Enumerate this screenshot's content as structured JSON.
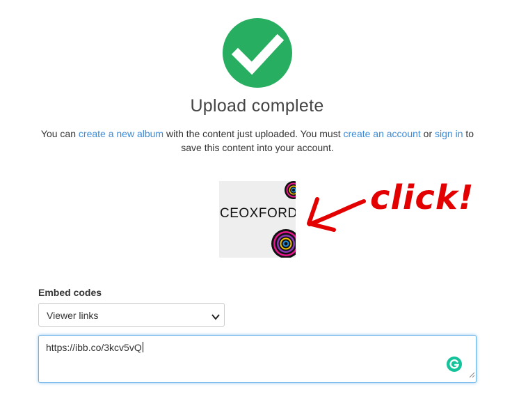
{
  "upload": {
    "title": "Upload complete",
    "message": {
      "part1": "You can ",
      "link_album": "create a new album",
      "part2": " with the content just uploaded. You must ",
      "link_account": "create an account",
      "part3": " or ",
      "link_signin": "sign in",
      "part4": " to save this content into your account."
    },
    "image": {
      "text": "CEOXFORD"
    },
    "annotation": {
      "text": "click!",
      "color": "#e30000"
    }
  },
  "embed": {
    "label": "Embed codes",
    "select_value": "Viewer links",
    "textarea_value": "https://ibb.co/3kcv5vQ",
    "grammarly_icon": "grammarly-icon"
  },
  "colors": {
    "success": "#27ae60",
    "link": "#3b8ad6",
    "focus": "#66afe9",
    "grammarly": "#15c39a"
  }
}
